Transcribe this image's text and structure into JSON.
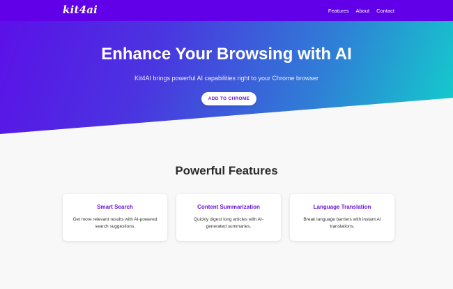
{
  "nav": {
    "logo": "kit4ai",
    "links": [
      "Features",
      "About",
      "Contact"
    ]
  },
  "hero": {
    "title": "Enhance Your Browsing with AI",
    "subtitle": "Kit4AI brings powerful AI capabilities right to your Chrome browser",
    "cta_label": "ADD TO CHROME"
  },
  "features": {
    "heading": "Powerful Features",
    "cards": [
      {
        "title": "Smart Search",
        "description": "Get more relevant results with AI-powered search suggestions."
      },
      {
        "title": "Content Summarization",
        "description": "Quickly digest long articles with AI-generated summaries."
      },
      {
        "title": "Language Translation",
        "description": "Break language barriers with instant AI translations."
      }
    ]
  },
  "colors": {
    "nav_bg": "#6100e8",
    "gradient_start": "#5c0fe8",
    "gradient_end": "#12d0cc",
    "accent": "#6a12d8",
    "page_bg": "#f8f8f8"
  }
}
